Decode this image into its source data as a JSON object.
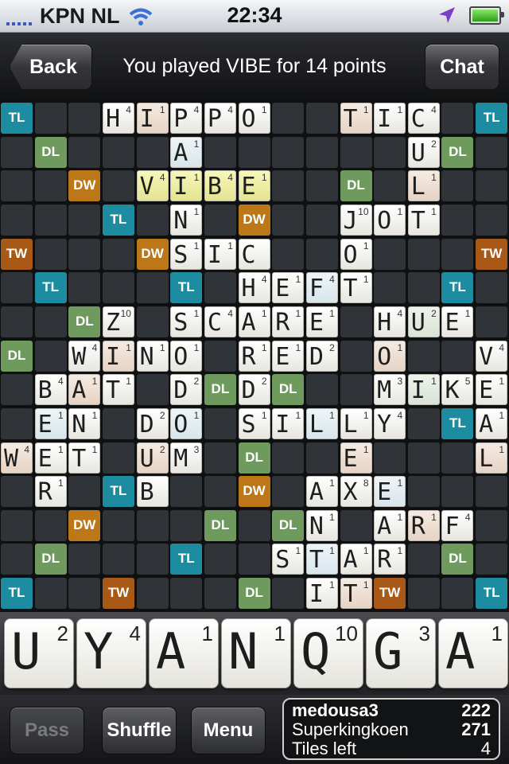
{
  "status_bar": {
    "carrier": "KPN NL",
    "time": "22:34"
  },
  "header": {
    "back_label": "Back",
    "title": "You played VIBE for 14 points",
    "chat_label": "Chat"
  },
  "board": {
    "bonus_labels": {
      "TL": "TL",
      "DL": "DL",
      "DW": "DW",
      "TW": "TW"
    },
    "bonus_rows": [
      "T......T......T",
      ".d...........d.",
      "..W.......d.W..",
      "...T...W...T...",
      "t...W.....W...t",
      ".T...T...T...T.",
      "..d...d.d...d..",
      "d..d...d...d..d",
      "..d...d.d...d..",
      ".T...T...T...T.",
      "t...W..d..W...t",
      "...T...W...T...",
      "..W...d.d...W..",
      ".d...T...T...d.",
      "T..t...d...t..T"
    ],
    "tiles": [
      {
        "r": 0,
        "c": 3,
        "l": "H",
        "p": "4"
      },
      {
        "r": 0,
        "c": 4,
        "l": "I",
        "p": "1",
        "t": "o"
      },
      {
        "r": 0,
        "c": 5,
        "l": "P",
        "p": "4"
      },
      {
        "r": 0,
        "c": 6,
        "l": "P",
        "p": "4"
      },
      {
        "r": 0,
        "c": 7,
        "l": "O",
        "p": "1"
      },
      {
        "r": 0,
        "c": 10,
        "l": "T",
        "p": "1",
        "t": "o"
      },
      {
        "r": 0,
        "c": 11,
        "l": "I",
        "p": "1"
      },
      {
        "r": 0,
        "c": 12,
        "l": "C",
        "p": "4"
      },
      {
        "r": 1,
        "c": 5,
        "l": "A",
        "p": "1",
        "t": "b"
      },
      {
        "r": 1,
        "c": 12,
        "l": "U",
        "p": "2"
      },
      {
        "r": 2,
        "c": 4,
        "l": "V",
        "p": "4",
        "t": "h"
      },
      {
        "r": 2,
        "c": 5,
        "l": "I",
        "p": "1",
        "t": "h"
      },
      {
        "r": 2,
        "c": 6,
        "l": "B",
        "p": "4",
        "t": "h"
      },
      {
        "r": 2,
        "c": 7,
        "l": "E",
        "p": "1",
        "t": "h"
      },
      {
        "r": 2,
        "c": 12,
        "l": "L",
        "p": "1",
        "t": "o"
      },
      {
        "r": 3,
        "c": 5,
        "l": "N",
        "p": "1"
      },
      {
        "r": 3,
        "c": 10,
        "l": "J",
        "p": "10"
      },
      {
        "r": 3,
        "c": 11,
        "l": "O",
        "p": "1"
      },
      {
        "r": 3,
        "c": 12,
        "l": "T",
        "p": "1"
      },
      {
        "r": 4,
        "c": 5,
        "l": "S",
        "p": "1"
      },
      {
        "r": 4,
        "c": 6,
        "l": "I",
        "p": "1"
      },
      {
        "r": 4,
        "c": 7,
        "l": "C",
        "p": ""
      },
      {
        "r": 4,
        "c": 10,
        "l": "O",
        "p": "1"
      },
      {
        "r": 5,
        "c": 7,
        "l": "H",
        "p": "4"
      },
      {
        "r": 5,
        "c": 8,
        "l": "E",
        "p": "1"
      },
      {
        "r": 5,
        "c": 9,
        "l": "F",
        "p": "4",
        "t": "b"
      },
      {
        "r": 5,
        "c": 10,
        "l": "T",
        "p": "1"
      },
      {
        "r": 6,
        "c": 3,
        "l": "Z",
        "p": "10"
      },
      {
        "r": 6,
        "c": 5,
        "l": "S",
        "p": "1"
      },
      {
        "r": 6,
        "c": 6,
        "l": "C",
        "p": "4"
      },
      {
        "r": 6,
        "c": 7,
        "l": "A",
        "p": "1"
      },
      {
        "r": 6,
        "c": 8,
        "l": "R",
        "p": "1"
      },
      {
        "r": 6,
        "c": 9,
        "l": "E",
        "p": "1"
      },
      {
        "r": 6,
        "c": 11,
        "l": "H",
        "p": "4"
      },
      {
        "r": 6,
        "c": 12,
        "l": "U",
        "p": "2",
        "t": "g"
      },
      {
        "r": 6,
        "c": 13,
        "l": "E",
        "p": "1"
      },
      {
        "r": 7,
        "c": 2,
        "l": "W",
        "p": "4"
      },
      {
        "r": 7,
        "c": 3,
        "l": "I",
        "p": "1",
        "t": "o"
      },
      {
        "r": 7,
        "c": 4,
        "l": "N",
        "p": "1"
      },
      {
        "r": 7,
        "c": 5,
        "l": "O",
        "p": "1"
      },
      {
        "r": 7,
        "c": 7,
        "l": "R",
        "p": "1"
      },
      {
        "r": 7,
        "c": 8,
        "l": "E",
        "p": "1"
      },
      {
        "r": 7,
        "c": 9,
        "l": "D",
        "p": "2"
      },
      {
        "r": 7,
        "c": 11,
        "l": "O",
        "p": "1",
        "t": "o"
      },
      {
        "r": 7,
        "c": 14,
        "l": "V",
        "p": "4"
      },
      {
        "r": 8,
        "c": 1,
        "l": "B",
        "p": "4"
      },
      {
        "r": 8,
        "c": 2,
        "l": "A",
        "p": "1",
        "t": "o"
      },
      {
        "r": 8,
        "c": 3,
        "l": "T",
        "p": "1"
      },
      {
        "r": 8,
        "c": 5,
        "l": "D",
        "p": "2"
      },
      {
        "r": 8,
        "c": 7,
        "l": "D",
        "p": "2"
      },
      {
        "r": 8,
        "c": 11,
        "l": "M",
        "p": "3"
      },
      {
        "r": 8,
        "c": 12,
        "l": "I",
        "p": "1",
        "t": "g"
      },
      {
        "r": 8,
        "c": 13,
        "l": "K",
        "p": "5"
      },
      {
        "r": 8,
        "c": 14,
        "l": "E",
        "p": "1"
      },
      {
        "r": 9,
        "c": 1,
        "l": "E",
        "p": "1",
        "t": "b"
      },
      {
        "r": 9,
        "c": 2,
        "l": "N",
        "p": "1"
      },
      {
        "r": 9,
        "c": 4,
        "l": "D",
        "p": "2"
      },
      {
        "r": 9,
        "c": 5,
        "l": "O",
        "p": "1",
        "t": "b"
      },
      {
        "r": 9,
        "c": 7,
        "l": "S",
        "p": "1"
      },
      {
        "r": 9,
        "c": 8,
        "l": "I",
        "p": "1"
      },
      {
        "r": 9,
        "c": 9,
        "l": "L",
        "p": "1",
        "t": "b"
      },
      {
        "r": 9,
        "c": 10,
        "l": "L",
        "p": "1"
      },
      {
        "r": 9,
        "c": 11,
        "l": "Y",
        "p": "4"
      },
      {
        "r": 9,
        "c": 14,
        "l": "A",
        "p": "1"
      },
      {
        "r": 10,
        "c": 0,
        "l": "W",
        "p": "4",
        "t": "o"
      },
      {
        "r": 10,
        "c": 1,
        "l": "E",
        "p": "1"
      },
      {
        "r": 10,
        "c": 2,
        "l": "T",
        "p": "1"
      },
      {
        "r": 10,
        "c": 4,
        "l": "U",
        "p": "2",
        "t": "o"
      },
      {
        "r": 10,
        "c": 5,
        "l": "M",
        "p": "3"
      },
      {
        "r": 10,
        "c": 10,
        "l": "E",
        "p": "1",
        "t": "o"
      },
      {
        "r": 10,
        "c": 14,
        "l": "L",
        "p": "1",
        "t": "o"
      },
      {
        "r": 11,
        "c": 1,
        "l": "R",
        "p": "1"
      },
      {
        "r": 11,
        "c": 4,
        "l": "B",
        "p": ""
      },
      {
        "r": 11,
        "c": 9,
        "l": "A",
        "p": "1"
      },
      {
        "r": 11,
        "c": 10,
        "l": "X",
        "p": "8"
      },
      {
        "r": 11,
        "c": 11,
        "l": "E",
        "p": "1",
        "t": "b"
      },
      {
        "r": 12,
        "c": 9,
        "l": "N",
        "p": "1"
      },
      {
        "r": 12,
        "c": 11,
        "l": "A",
        "p": "1"
      },
      {
        "r": 12,
        "c": 12,
        "l": "R",
        "p": "1",
        "t": "o"
      },
      {
        "r": 12,
        "c": 13,
        "l": "F",
        "p": "4"
      },
      {
        "r": 13,
        "c": 8,
        "l": "S",
        "p": "1"
      },
      {
        "r": 13,
        "c": 9,
        "l": "T",
        "p": "1",
        "t": "b"
      },
      {
        "r": 13,
        "c": 10,
        "l": "A",
        "p": "1"
      },
      {
        "r": 13,
        "c": 11,
        "l": "R",
        "p": "1"
      },
      {
        "r": 14,
        "c": 9,
        "l": "I",
        "p": "1"
      },
      {
        "r": 14,
        "c": 10,
        "l": "T",
        "p": "1",
        "t": "o"
      }
    ]
  },
  "rack": [
    {
      "letter": "U",
      "points": "2"
    },
    {
      "letter": "Y",
      "points": "4"
    },
    {
      "letter": "A",
      "points": "1"
    },
    {
      "letter": "N",
      "points": "1"
    },
    {
      "letter": "Q",
      "points": "10"
    },
    {
      "letter": "G",
      "points": "3"
    },
    {
      "letter": "A",
      "points": "1"
    }
  ],
  "footer": {
    "pass_label": "Pass",
    "shuffle_label": "Shuffle",
    "menu_label": "Menu"
  },
  "scores": {
    "player1": {
      "name": "medousa3",
      "score": "222"
    },
    "player2": {
      "name": "Superkingkoen",
      "score": "271"
    },
    "tiles_left_label": "Tiles left",
    "tiles_left": "4"
  }
}
